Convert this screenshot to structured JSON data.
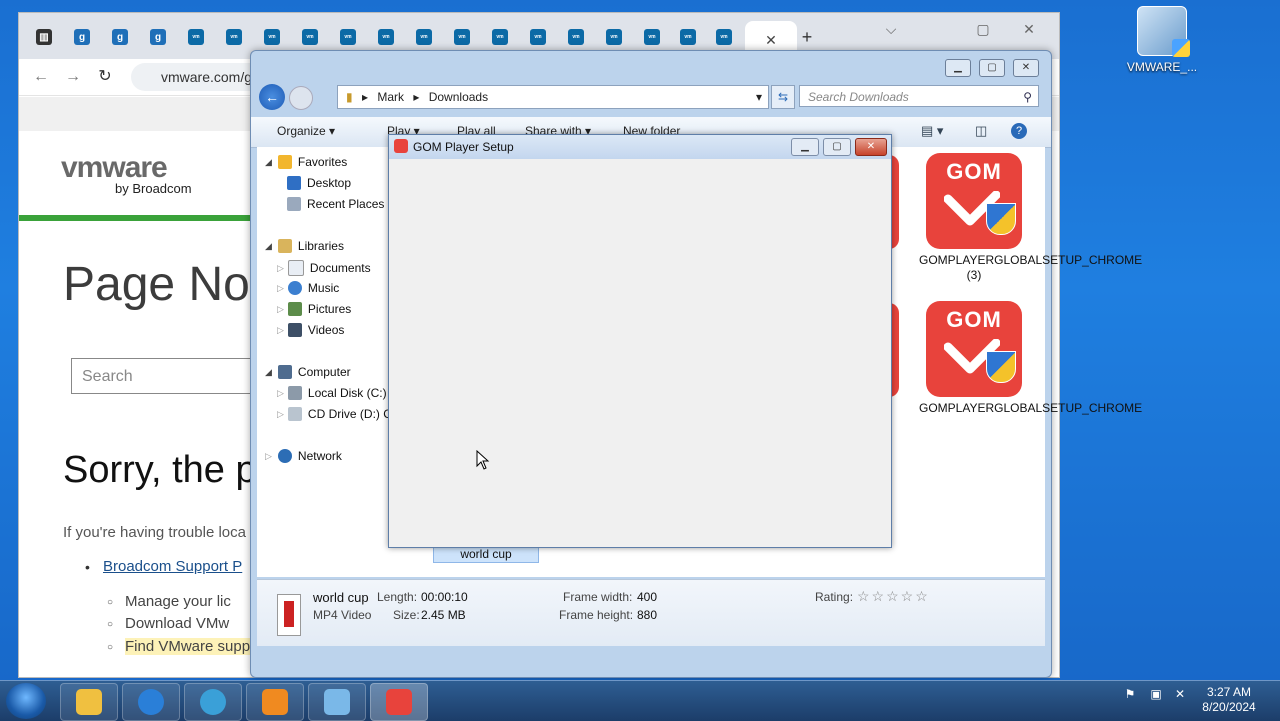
{
  "desktop": {
    "icon_label": "VMWARE_..."
  },
  "browser": {
    "tab_close": "✕",
    "new_tab": "+",
    "win_min": "⌵",
    "win_max": "▢",
    "win_close": "✕",
    "url": "vmware.com/g",
    "nav": {
      "back": "←",
      "forward": "→",
      "reload": "↻"
    },
    "page": {
      "logo": "vmware",
      "logo_sub": "by Broadcom",
      "heading": "Page No",
      "search_placeholder": "Search",
      "subheading": "Sorry, the p",
      "paragraph": "If you're having trouble loca",
      "link": "Broadcom Support P",
      "sub_items": [
        "Manage your lic",
        "Download VMw",
        "Find VMware support by products"
      ]
    }
  },
  "explorer": {
    "breadcrumb": [
      "Mark",
      "Downloads"
    ],
    "search_placeholder": "Search Downloads",
    "commands": [
      "Organize ▾",
      "Play ▾",
      "Play all",
      "Share with ▾",
      "New folder"
    ],
    "nav": {
      "favorites": "Favorites",
      "desktop": "Desktop",
      "recent": "Recent Places",
      "libraries": "Libraries",
      "documents": "Documents",
      "music": "Music",
      "pictures": "Pictures",
      "videos": "Videos",
      "computer": "Computer",
      "local_disk": "Local Disk (C:)",
      "cd_drive": "CD Drive (D:) C",
      "network": "Network"
    },
    "files": [
      {
        "label": "GOMPLAYERGLOBALSETUP_CHROME (3)"
      },
      {
        "label": "GOMPLAYERGLOBALSETUP_CHROME"
      }
    ],
    "gom_word": "GOM",
    "partial_label": "O",
    "selected_item": "world cup",
    "details": {
      "name": "world cup",
      "type": "MP4 Video",
      "length_label": "Length:",
      "length": "00:00:10",
      "size_label": "Size:",
      "size": "2.45 MB",
      "fw_label": "Frame width:",
      "frame_width": "400",
      "fh_label": "Frame height:",
      "frame_height": "880",
      "rating_label": "Rating:",
      "rating_stars": "☆☆☆☆☆"
    }
  },
  "dialog": {
    "title": "GOM Player Setup"
  },
  "taskbar": {
    "time": "3:27 AM",
    "date": "8/20/2024",
    "colors": [
      "#f0c040",
      "#2a7fd8",
      "#3aa0d8",
      "#f08a20",
      "#7ab8e8",
      "#e8433c"
    ]
  }
}
